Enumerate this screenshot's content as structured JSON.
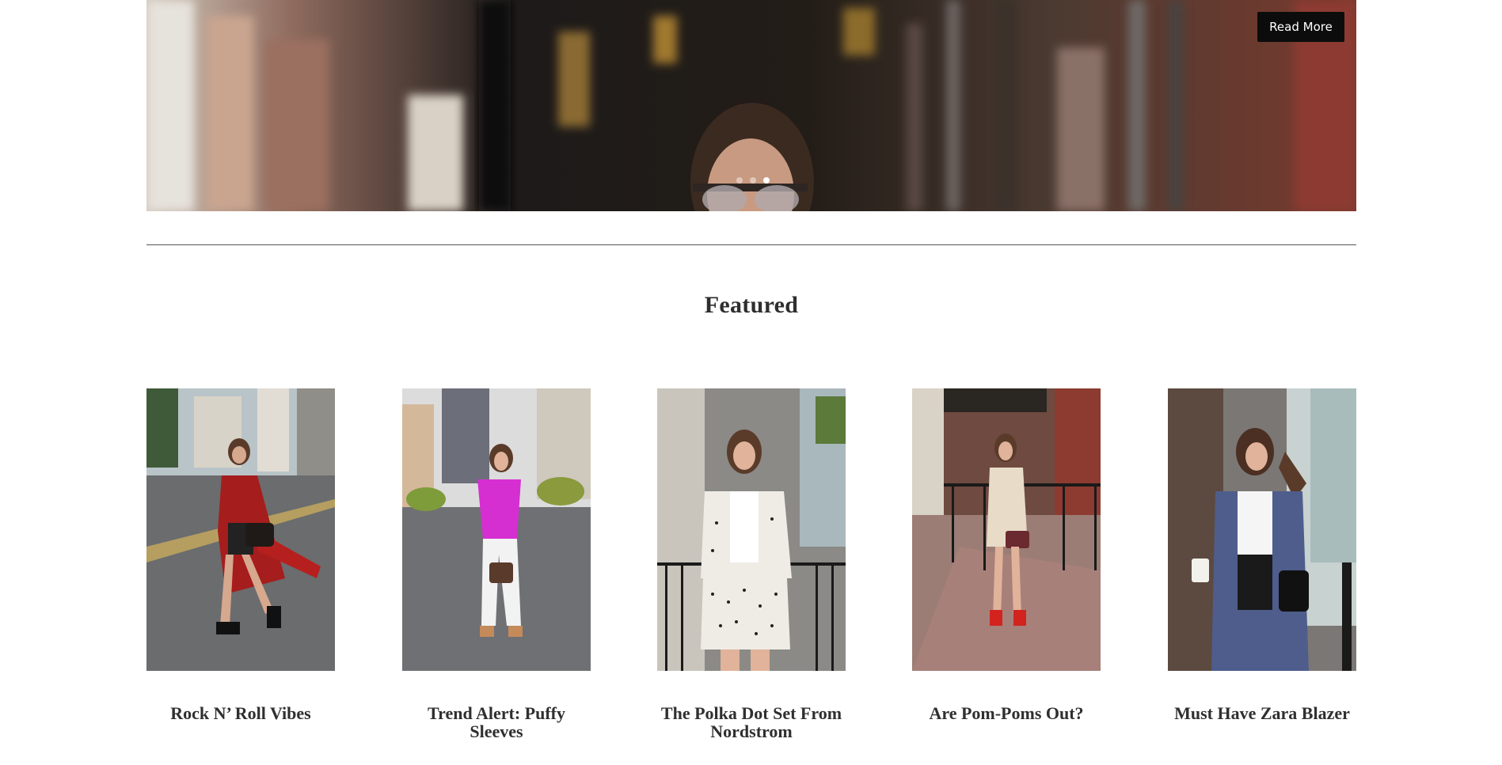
{
  "hero": {
    "read_more_label": "Read More",
    "slide_count": 3,
    "active_slide": 3
  },
  "featured": {
    "title": "Featured",
    "posts": [
      {
        "title": "Rock N’ Roll Vibes"
      },
      {
        "title": "Trend Alert: Puffy Sleeves"
      },
      {
        "title": "The Polka Dot Set From Nordstrom"
      },
      {
        "title": "Are Pom-Poms Out?"
      },
      {
        "title": "Must Have Zara Blazer"
      }
    ]
  },
  "colors": {
    "button_bg": "#0c0c0c",
    "divider": "#555555",
    "heading": "#2e2e2e"
  }
}
